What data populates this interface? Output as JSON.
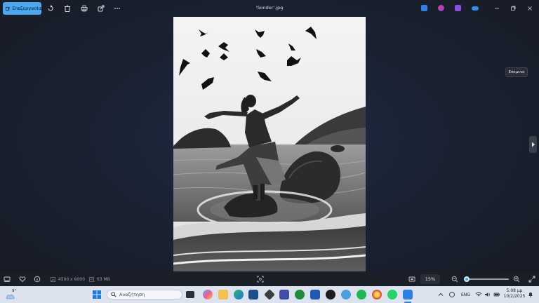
{
  "window": {
    "title": "'Sonder'.jpg"
  },
  "toolbar": {
    "edit_label": "Επεξεργασία"
  },
  "navigation": {
    "next_tooltip": "Επόμενο"
  },
  "status": {
    "dimensions": "4500 x 6000",
    "file_size": "63 MB",
    "zoom": "15%",
    "zoom_level_percent": 15
  },
  "taskbar": {
    "weather_temp": "9°",
    "search_placeholder": "Αναζήτηση",
    "language": "ENG",
    "time": "5:08 μμ",
    "date": "10/2/2025"
  },
  "colors": {
    "accent": "#4aa8f0",
    "background": "#1b1f2a",
    "taskbar": "#dde3ee"
  }
}
